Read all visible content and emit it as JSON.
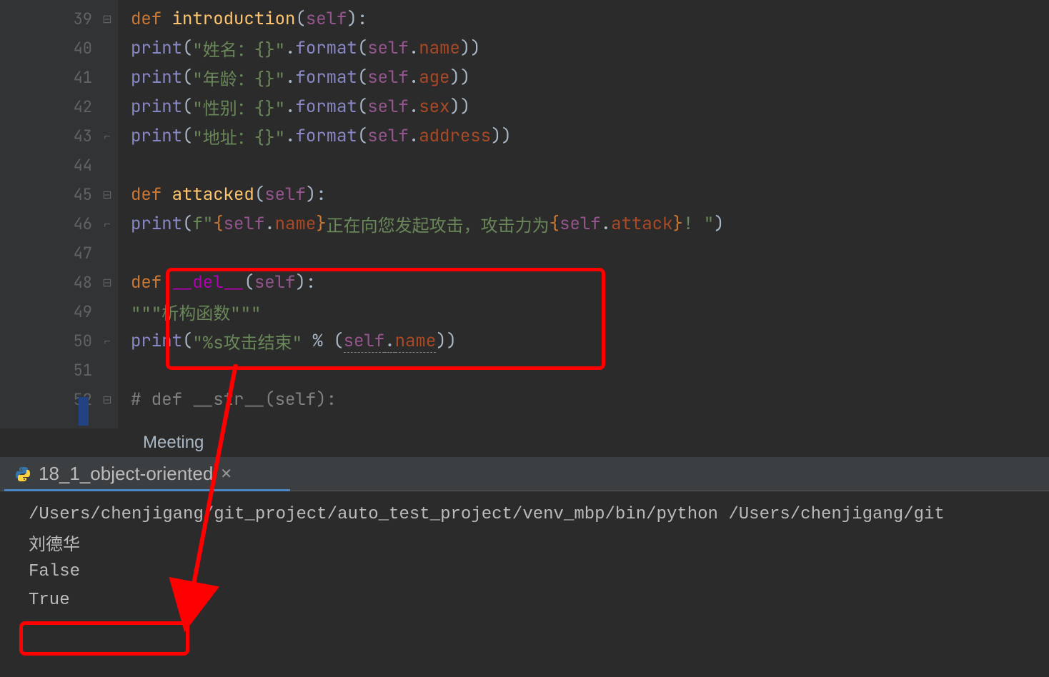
{
  "editor": {
    "lines": {
      "l39": {
        "num": "39",
        "def": "def ",
        "fname": "introduction",
        "lp": "(",
        "self": "self",
        "rp": "):"
      },
      "l40": {
        "num": "40",
        "print": "print",
        "lp": "(",
        "s1": "\"姓名：{}\"",
        "dot": ".",
        "fmt": "format",
        "lp2": "(",
        "self": "self",
        "d2": ".",
        "attr": "name",
        "rp": "))"
      },
      "l41": {
        "num": "41",
        "print": "print",
        "lp": "(",
        "s1": "\"年龄：{}\"",
        "dot": ".",
        "fmt": "format",
        "lp2": "(",
        "self": "self",
        "d2": ".",
        "attr": "age",
        "rp": "))"
      },
      "l42": {
        "num": "42",
        "print": "print",
        "lp": "(",
        "s1": "\"性别：{}\"",
        "dot": ".",
        "fmt": "format",
        "lp2": "(",
        "self": "self",
        "d2": ".",
        "attr": "sex",
        "rp": "))"
      },
      "l43": {
        "num": "43",
        "print": "print",
        "lp": "(",
        "s1": "\"地址：{}\"",
        "dot": ".",
        "fmt": "format",
        "lp2": "(",
        "self": "self",
        "d2": ".",
        "attr": "address",
        "rp": "))"
      },
      "l44": {
        "num": "44"
      },
      "l45": {
        "num": "45",
        "def": "def ",
        "fname": "attacked",
        "lp": "(",
        "self": "self",
        "rp": "):"
      },
      "l46": {
        "num": "46",
        "print": "print",
        "lp": "(",
        "fpre": "f\"",
        "lb": "{",
        "self": "self",
        "d": ".",
        "attr": "name",
        "rb": "}",
        "mid": "正在向您发起攻击，攻击力为",
        "lb2": "{",
        "self2": "self",
        "d2": ".",
        "attr2": "attack",
        "rb2": "}",
        "tail": "! \"",
        "rp": ")"
      },
      "l47": {
        "num": "47"
      },
      "l48": {
        "num": "48",
        "def": "def ",
        "fname": "__del__",
        "lp": "(",
        "self": "self",
        "rp": "):"
      },
      "l49": {
        "num": "49",
        "doc": "\"\"\"析构函数\"\"\""
      },
      "l50": {
        "num": "50",
        "print": "print",
        "lp": "(",
        "s1": "\"%s攻击结束\" ",
        "pct": "% (",
        "self": "self",
        "d": ".",
        "attr": "name",
        "rp": "))"
      },
      "l51": {
        "num": "51"
      },
      "l52": {
        "num": "52",
        "cmt": "# def __str__(self):"
      }
    }
  },
  "breadcrumb": {
    "label": "Meeting"
  },
  "tab": {
    "title": "18_1_object-oriented"
  },
  "console": {
    "cmd": "/Users/chenjigang/git_project/auto_test_project/venv_mbp/bin/python /Users/chenjigang/git",
    "out1": "刘德华",
    "out2": "False",
    "out3": "True"
  }
}
